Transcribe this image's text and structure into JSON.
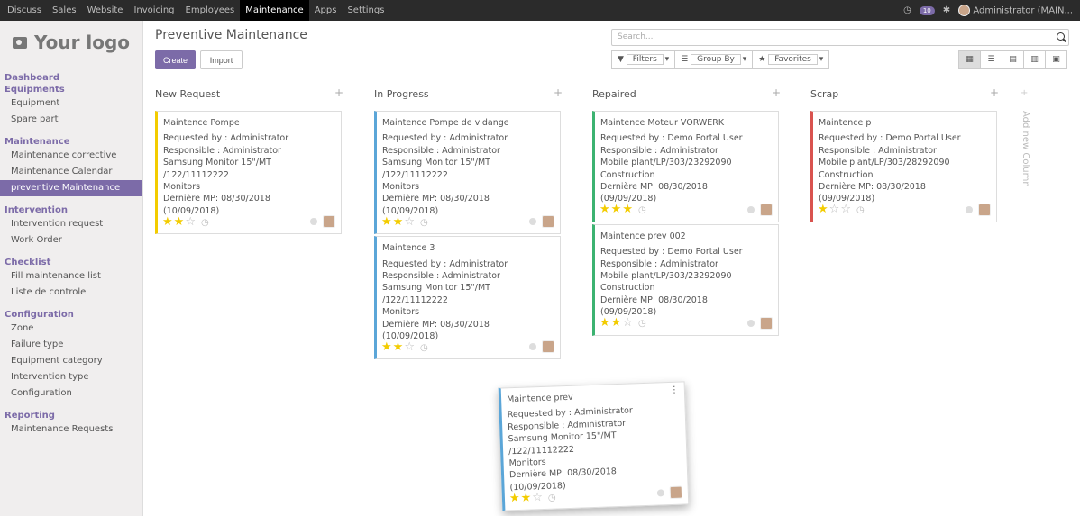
{
  "topbar": {
    "menus": [
      "Discuss",
      "Sales",
      "Website",
      "Invoicing",
      "Employees",
      "Maintenance",
      "Apps",
      "Settings"
    ],
    "active": "Maintenance",
    "badge": "10",
    "user": "Administrator (MAIN..."
  },
  "logo": "Your logo",
  "sidebar": {
    "sections": [
      {
        "head": "Dashboard",
        "items": []
      },
      {
        "head": "Equipments",
        "items": [
          "Equipment",
          "Spare part"
        ]
      },
      {
        "head": "Maintenance",
        "items": [
          "Maintenance corrective",
          "Maintenance Calendar",
          "preventive Maintenance"
        ]
      },
      {
        "head": "Intervention",
        "items": [
          "Intervention request",
          "Work Order"
        ]
      },
      {
        "head": "Checklist",
        "items": [
          "Fill maintenance list",
          "Liste de controle"
        ]
      },
      {
        "head": "Configuration",
        "items": [
          "Zone",
          "Failure type",
          "Equipment category",
          "Intervention type",
          "Configuration"
        ]
      },
      {
        "head": "Reporting",
        "items": [
          "Maintenance Requests"
        ]
      }
    ],
    "active": "preventive Maintenance"
  },
  "page": {
    "title": "Preventive Maintenance",
    "create": "Create",
    "import": "Import",
    "search_placeholder": "Search...",
    "filters": "Filters",
    "groupby": "Group By",
    "favorites": "Favorites"
  },
  "columns": [
    {
      "title": "New Request",
      "color": "#f3cc00"
    },
    {
      "title": "In Progress",
      "color": "#5ba6d8"
    },
    {
      "title": "Repaired",
      "color": "#3cb371"
    },
    {
      "title": "Scrap",
      "color": "#d9534f"
    }
  ],
  "add_column": "Add new Column",
  "cards": [
    {
      "col": 0,
      "name": "Maintence Pompe",
      "lines": [
        "Requested by : Administrator",
        "Responsible : Administrator",
        "Samsung Monitor 15\"/MT",
        "/122/11112222",
        "Monitors",
        "Dernière MP: 08/30/2018",
        "(10/09/2018)"
      ],
      "stars": 2
    },
    {
      "col": 1,
      "name": "Maintence Pompe de vidange",
      "lines": [
        "Requested by : Administrator",
        "Responsible : Administrator",
        "Samsung Monitor 15\"/MT",
        "/122/11112222",
        "Monitors",
        "Dernière MP: 08/30/2018",
        "(10/09/2018)"
      ],
      "stars": 2
    },
    {
      "col": 1,
      "name": "Maintence 3",
      "lines": [
        "Requested by : Administrator",
        "Responsible : Administrator",
        "Samsung Monitor 15\"/MT",
        "/122/11112222",
        "Monitors",
        "Dernière MP: 08/30/2018",
        "(10/09/2018)"
      ],
      "stars": 2
    },
    {
      "col": 2,
      "name": "Maintence Moteur VORWERK",
      "lines": [
        "Requested by : Demo Portal User",
        "Responsible : Administrator",
        "Mobile plant/LP/303/23292090",
        "Construction",
        "Dernière MP: 08/30/2018",
        "(09/09/2018)"
      ],
      "stars": 3
    },
    {
      "col": 2,
      "name": "Maintence prev 002",
      "lines": [
        "Requested by : Demo Portal User",
        "Responsible : Administrator",
        "Mobile plant/LP/303/23292090",
        "Construction",
        "Dernière MP: 08/30/2018",
        "(09/09/2018)"
      ],
      "stars": 2
    },
    {
      "col": 3,
      "name": "Maintence p",
      "lines": [
        "Requested by : Demo Portal User",
        "Responsible : Administrator",
        "Mobile plant/LP/303/28292090",
        "Construction",
        "Dernière MP: 08/30/2018",
        "(09/09/2018)"
      ],
      "stars": 1
    },
    {
      "col": -1,
      "name": "Maintence prev",
      "lines": [
        "Requested by : Administrator",
        "Responsible : Administrator",
        "Samsung Monitor 15\"/MT",
        "/122/11112222",
        "Monitors",
        "Dernière MP: 08/30/2018",
        "(10/09/2018)"
      ],
      "stars": 2
    }
  ]
}
